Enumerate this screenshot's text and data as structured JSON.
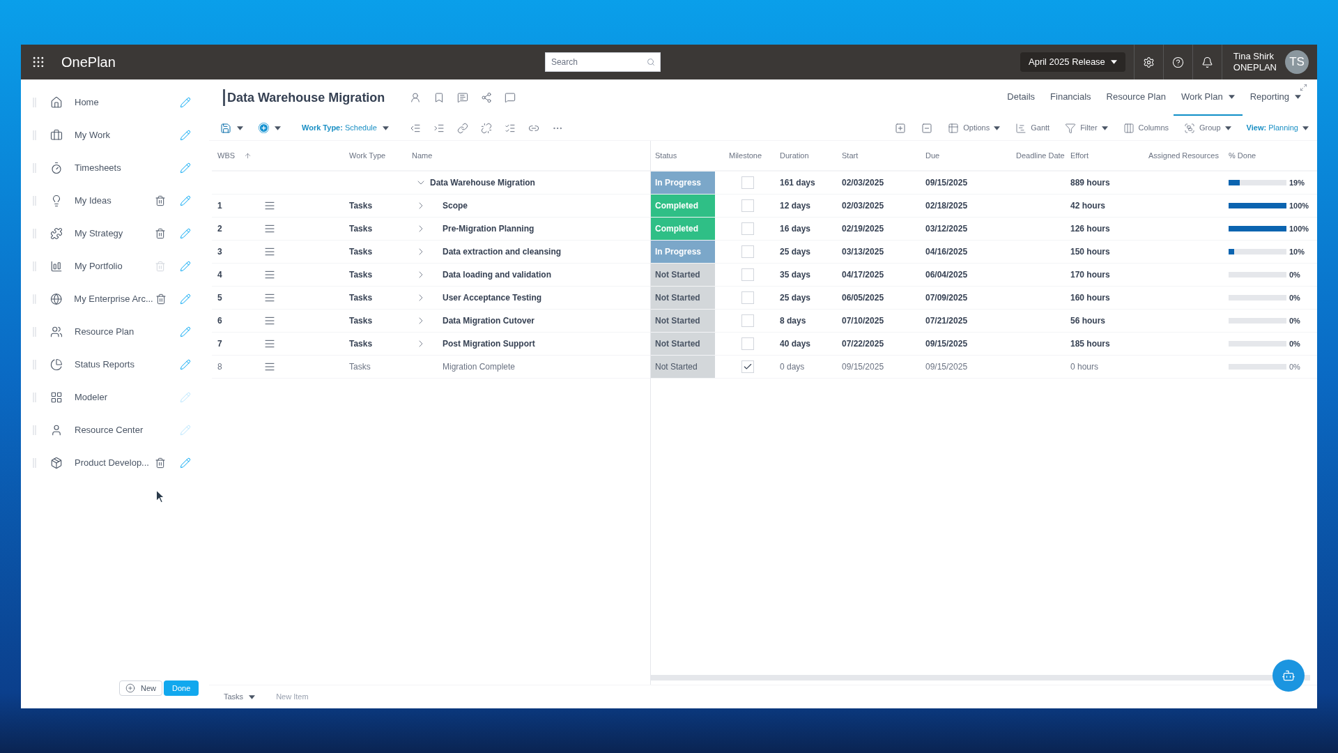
{
  "topbar": {
    "app_name": "OnePlan",
    "search": {
      "placeholder": "Search"
    },
    "release": "April 2025 Release",
    "user": {
      "name": "Tina Shirk",
      "org": "ONEPLAN",
      "initials": "TS"
    }
  },
  "sidebar": {
    "items": [
      {
        "label": "Home",
        "deletable": false,
        "edit_disabled": false
      },
      {
        "label": "My Work",
        "deletable": false,
        "edit_disabled": false
      },
      {
        "label": "Timesheets",
        "deletable": false,
        "edit_disabled": false
      },
      {
        "label": "My Ideas",
        "deletable": true,
        "delete_disabled": false,
        "edit_disabled": false
      },
      {
        "label": "My Strategy",
        "deletable": true,
        "delete_disabled": false,
        "edit_disabled": false
      },
      {
        "label": "My Portfolio",
        "deletable": true,
        "delete_disabled": true,
        "edit_disabled": false
      },
      {
        "label": "My Enterprise Arc...",
        "deletable": true,
        "delete_disabled": false,
        "edit_disabled": false
      },
      {
        "label": "Resource Plan",
        "deletable": false,
        "edit_disabled": false
      },
      {
        "label": "Status Reports",
        "deletable": false,
        "edit_disabled": false
      },
      {
        "label": "Modeler",
        "deletable": false,
        "edit_disabled": true
      },
      {
        "label": "Resource Center",
        "deletable": false,
        "edit_disabled": true
      },
      {
        "label": "Product Develop...",
        "deletable": true,
        "delete_disabled": false,
        "edit_disabled": false
      }
    ],
    "buttons": {
      "new": "New",
      "done": "Done"
    }
  },
  "project": {
    "title": "Data Warehouse Migration"
  },
  "tabs": [
    {
      "label": "Details",
      "selected": false,
      "dropdown": false
    },
    {
      "label": "Financials",
      "selected": false,
      "dropdown": false
    },
    {
      "label": "Resource Plan",
      "selected": false,
      "dropdown": false
    },
    {
      "label": "Work Plan",
      "selected": true,
      "dropdown": true
    },
    {
      "label": "Reporting",
      "selected": false,
      "dropdown": true
    }
  ],
  "toolbar": {
    "work_type_label": "Work Type:",
    "work_type_value": "Schedule",
    "options": "Options",
    "gantt": "Gantt",
    "filter": "Filter",
    "columns": "Columns",
    "group": "Group",
    "view_label": "View:",
    "view_value": "Planning"
  },
  "table": {
    "left_columns": [
      "WBS",
      "Work Type",
      "Name"
    ],
    "right_columns": [
      "Status",
      "Milestone",
      "Duration",
      "Start",
      "Due",
      "Deadline Date",
      "Effort",
      "Assigned Resources",
      "% Done"
    ],
    "rows": [
      {
        "kind": "summary",
        "name": "Data Warehouse Migration",
        "expanded": true,
        "status": "In Progress",
        "color": "#7ba7c9",
        "milestone": false,
        "duration": "161 days",
        "start": "02/03/2025",
        "due": "09/15/2025",
        "effort": "889 hours",
        "level": 0.19,
        "percent": "19%",
        "children": [
          {
            "kind": "summary",
            "wbs": "1",
            "work_type": "Tasks",
            "name": "Scope",
            "expanded": false,
            "status": "Completed",
            "color": "#2fbf86",
            "milestone": false,
            "duration": "12 days",
            "start": "02/03/2025",
            "due": "02/18/2025",
            "effort": "42 hours",
            "level": 1,
            "percent": "100%"
          },
          {
            "kind": "summary",
            "wbs": "2",
            "work_type": "Tasks",
            "name": "Pre-Migration Planning",
            "expanded": false,
            "status": "Completed",
            "color": "#2fbf86",
            "milestone": false,
            "duration": "16 days",
            "start": "02/19/2025",
            "due": "03/12/2025",
            "effort": "126 hours",
            "level": 1,
            "percent": "100%"
          },
          {
            "kind": "summary",
            "wbs": "3",
            "work_type": "Tasks",
            "name": "Data extraction and cleansing",
            "expanded": false,
            "status": "In Progress",
            "color": "#7ba7c9",
            "milestone": false,
            "duration": "25 days",
            "start": "03/13/2025",
            "due": "04/16/2025",
            "effort": "150 hours",
            "level": 0.1,
            "percent": "10%"
          },
          {
            "kind": "summary",
            "wbs": "4",
            "work_type": "Tasks",
            "name": "Data loading and validation",
            "expanded": false,
            "status": "Not Started",
            "color": "#d3d7da",
            "milestone": false,
            "duration": "35 days",
            "start": "04/17/2025",
            "due": "06/04/2025",
            "effort": "170 hours",
            "level": 0,
            "percent": "0%"
          },
          {
            "kind": "summary",
            "wbs": "5",
            "work_type": "Tasks",
            "name": "User Acceptance Testing",
            "expanded": false,
            "status": "Not Started",
            "color": "#d3d7da",
            "milestone": false,
            "duration": "25 days",
            "start": "06/05/2025",
            "due": "07/09/2025",
            "effort": "160 hours",
            "level": 0,
            "percent": "0%"
          },
          {
            "kind": "summary",
            "wbs": "6",
            "work_type": "Tasks",
            "name": "Data Migration Cutover",
            "expanded": false,
            "status": "Not Started",
            "color": "#d3d7da",
            "milestone": false,
            "duration": "8 days",
            "start": "07/10/2025",
            "due": "07/21/2025",
            "effort": "56 hours",
            "level": 0,
            "percent": "0%"
          },
          {
            "kind": "summary",
            "wbs": "7",
            "work_type": "Tasks",
            "name": "Post Migration Support",
            "expanded": false,
            "status": "Not Started",
            "color": "#d3d7da",
            "milestone": false,
            "duration": "40 days",
            "start": "07/22/2025",
            "due": "09/15/2025",
            "effort": "185 hours",
            "level": 0,
            "percent": "0%"
          },
          {
            "kind": "milestone",
            "wbs": "8",
            "work_type": "Tasks",
            "name": "Migration Complete",
            "status": "Not Started",
            "color": "#d3d7da",
            "milestone": true,
            "duration": "0 days",
            "start": "09/15/2025",
            "due": "09/15/2025",
            "effort": "0 hours",
            "level": 0,
            "percent": "0%"
          }
        ]
      }
    ]
  },
  "footer": {
    "tasks": "Tasks",
    "new_item": "New Item"
  }
}
